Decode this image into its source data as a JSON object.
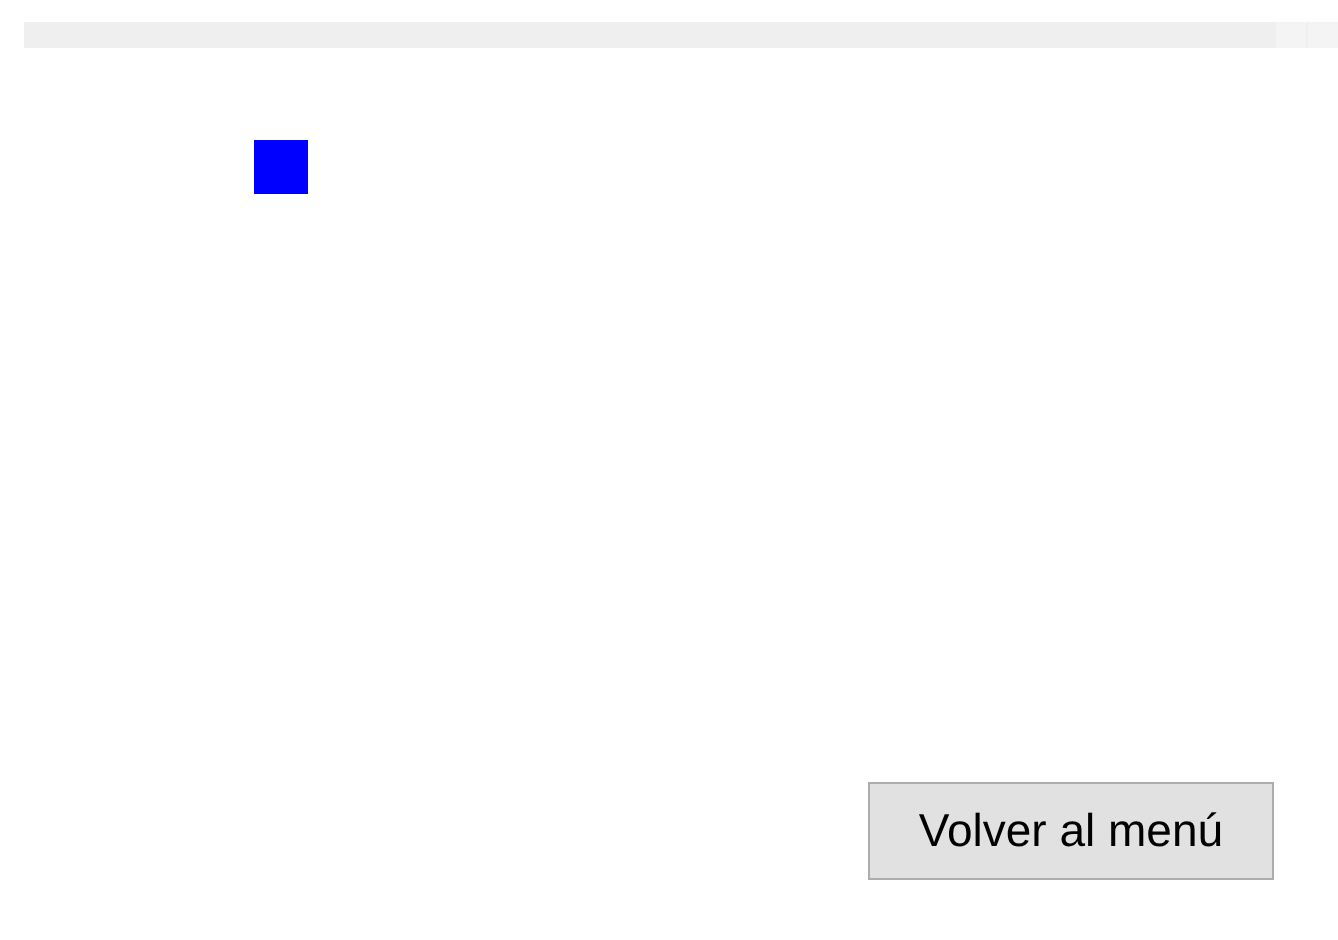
{
  "button": {
    "label": "Volver al menú"
  }
}
